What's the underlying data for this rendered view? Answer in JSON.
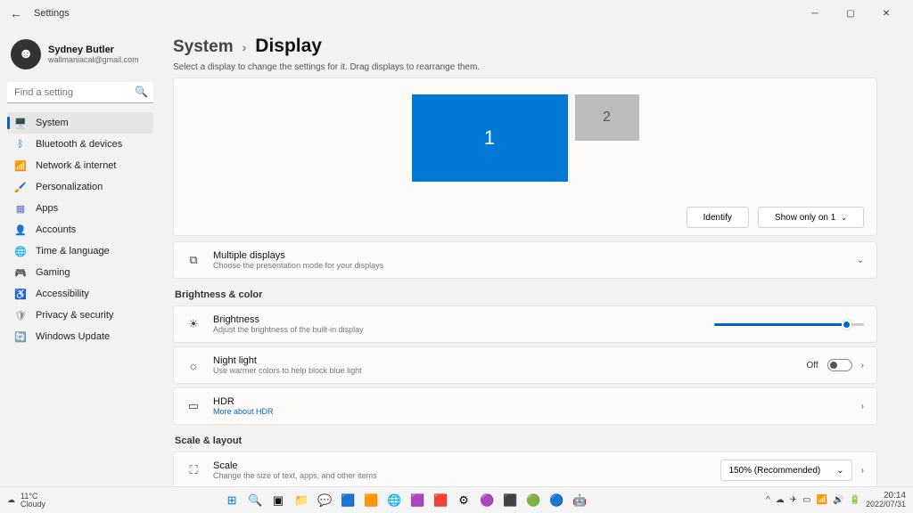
{
  "window": {
    "title": "Settings"
  },
  "user": {
    "name": "Sydney Butler",
    "email": "wallmaniacal@gmail.com"
  },
  "search": {
    "placeholder": "Find a setting"
  },
  "sidebar": {
    "items": [
      {
        "label": "System",
        "icon": "🖥️",
        "active": true
      },
      {
        "label": "Bluetooth & devices",
        "icon": "ᛒ"
      },
      {
        "label": "Network & internet",
        "icon": "📶"
      },
      {
        "label": "Personalization",
        "icon": "🖌️"
      },
      {
        "label": "Apps",
        "icon": "▦"
      },
      {
        "label": "Accounts",
        "icon": "👤"
      },
      {
        "label": "Time & language",
        "icon": "🌐"
      },
      {
        "label": "Gaming",
        "icon": "🎮"
      },
      {
        "label": "Accessibility",
        "icon": "♿"
      },
      {
        "label": "Privacy & security",
        "icon": "🛡"
      },
      {
        "label": "Windows Update",
        "icon": "🔄"
      }
    ]
  },
  "breadcrumb": {
    "parent": "System",
    "current": "Display"
  },
  "subtext": "Select a display to change the settings for it. Drag displays to rearrange them.",
  "arrange": {
    "displays": [
      {
        "id": "1"
      },
      {
        "id": "2"
      }
    ],
    "identify": "Identify",
    "show_on": "Show only on 1"
  },
  "rows": {
    "multi": {
      "title": "Multiple displays",
      "desc": "Choose the presentation mode for your displays"
    },
    "brightness": {
      "title": "Brightness",
      "desc": "Adjust the brightness of the built-in display"
    },
    "nightlight": {
      "title": "Night light",
      "desc": "Use warmer colors to help block blue light",
      "state": "Off"
    },
    "hdr": {
      "title": "HDR",
      "link": "More about HDR"
    },
    "scale": {
      "title": "Scale",
      "desc": "Change the size of text, apps, and other items",
      "value": "150% (Recommended)"
    }
  },
  "sections": {
    "brightness": "Brightness & color",
    "scale": "Scale & layout"
  },
  "taskbar": {
    "weather": {
      "temp": "11°C",
      "cond": "Cloudy"
    },
    "time": "20:14",
    "date": "2022/07/31"
  }
}
